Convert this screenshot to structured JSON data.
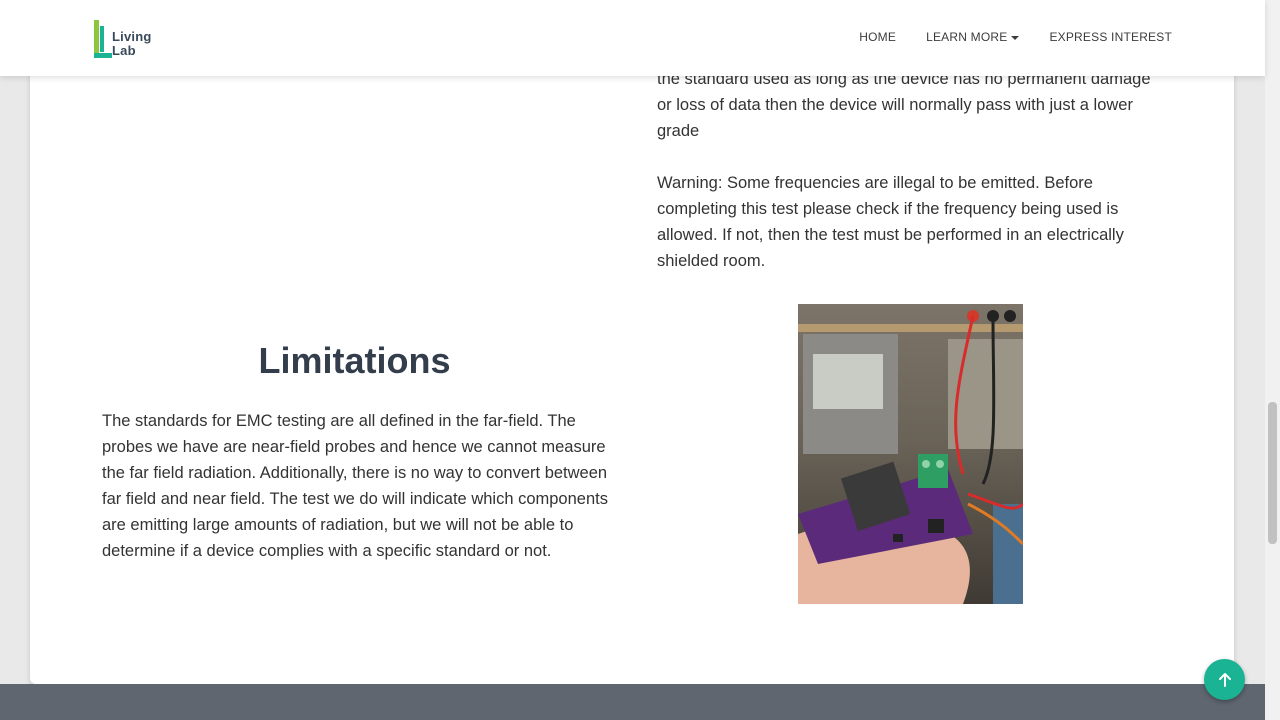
{
  "brand": {
    "line1": "Living",
    "line2": "Lab"
  },
  "nav": {
    "home": "HOME",
    "learn_more": "LEARN MORE",
    "express_interest": "EXPRESS INTEREST"
  },
  "content": {
    "top_paragraph": "the standard used as long as the device has no permanent damage or loss of data then the device will normally pass with just a lower grade",
    "warning_paragraph": "Warning: Some frequencies are illegal to be emitted. Before completing this test please check if the frequency being used is allowed. If not, then the test must be performed in an electrically shielded room.",
    "limitations_title": "Limitations",
    "limitations_paragraph": "The standards for EMC testing are all defined in the far-field. The probes we have are near-field probes and hence we cannot measure the far field radiation. Additionally, there is no way to convert between far field and near field. The test we do will indicate which components are emitting large amounts of radiation, but we will not be able to determine if a device complies with a specific standard or not."
  },
  "icons": {
    "logo": "living-lab-logo",
    "back_to_top": "arrow-up-icon",
    "learn_more_caret": "caret-down-icon"
  },
  "colors": {
    "accent": "#1ab394",
    "heading": "#333d4b",
    "footer": "#5f6670"
  }
}
